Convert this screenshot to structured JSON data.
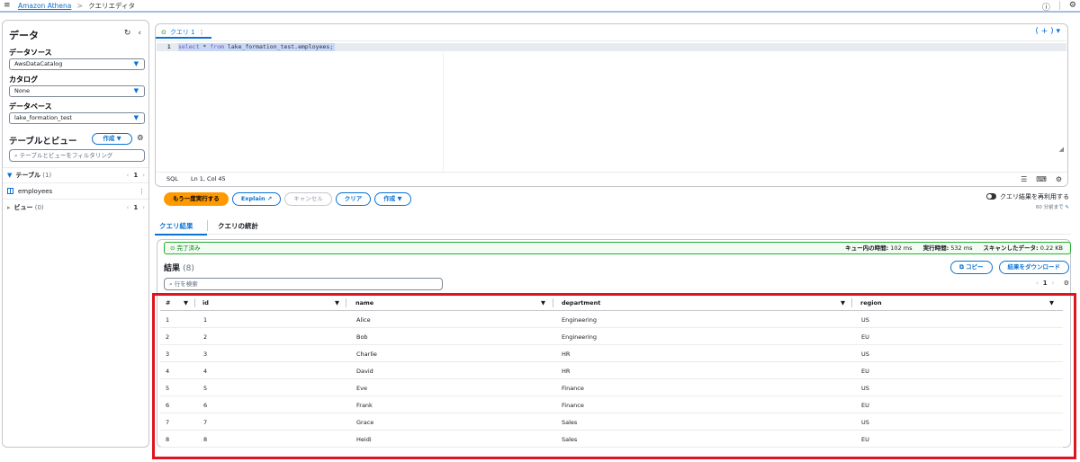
{
  "topbar": {
    "menu_icon": "menu-icon",
    "crumb_link": "Amazon Athena",
    "crumb_sep": ">",
    "crumb_current": "クエリエディタ"
  },
  "left": {
    "title": "データ",
    "datasource_label": "データソース",
    "datasource_value": "AwsDataCatalog",
    "catalog_label": "カタログ",
    "catalog_value": "None",
    "database_label": "データベース",
    "database_value": "lake_formation_test",
    "tables_views_title": "テーブルとビュー",
    "create_label": "作成 ▼",
    "filter_placeholder": "テーブルとビューをフィルタリング",
    "tables_label": "テーブル",
    "tables_count": "(1)",
    "tables_page": "1",
    "table_item": "employees",
    "views_label": "ビュー",
    "views_count": "(0)",
    "views_page": "1"
  },
  "editor": {
    "tab_label": "クエリ 1",
    "line_number": "1",
    "code_select": "select",
    "code_star": "*",
    "code_from": "from",
    "code_rest": "lake_formation_test.employees;",
    "lang": "SQL",
    "position": "Ln 1, Col 45",
    "add_tab": "( + ) ▾"
  },
  "actions": {
    "run_again": "もう一度実行する",
    "explain": "Explain",
    "cancel": "キャンセル",
    "clear": "クリア",
    "create": "作成 ▼",
    "reuse_label": "クエリ結果を再利用する",
    "reuse_sub": "60 分前まで"
  },
  "result_tabs": {
    "results": "クエリ結果",
    "stats": "クエリの統計"
  },
  "status": {
    "completed": "完了済み",
    "queue_label": "キュー内の時間:",
    "queue_value": "102 ms",
    "exec_label": "実行時間:",
    "exec_value": "532 ms",
    "scan_label": "スキャンしたデータ:",
    "scan_value": "0.22 KB"
  },
  "results": {
    "title": "結果",
    "count": "(8)",
    "copy": "コピー",
    "download": "結果をダウンロード",
    "search_placeholder": "行を検索",
    "page": "1"
  },
  "table": {
    "columns": [
      "#",
      "id",
      "name",
      "department",
      "region"
    ],
    "rows": [
      [
        "1",
        "1",
        "Alice",
        "Engineering",
        "US"
      ],
      [
        "2",
        "2",
        "Bob",
        "Engineering",
        "EU"
      ],
      [
        "3",
        "3",
        "Charlie",
        "HR",
        "US"
      ],
      [
        "4",
        "4",
        "David",
        "HR",
        "EU"
      ],
      [
        "5",
        "5",
        "Eve",
        "Finance",
        "US"
      ],
      [
        "6",
        "6",
        "Frank",
        "Finance",
        "EU"
      ],
      [
        "7",
        "7",
        "Grace",
        "Sales",
        "US"
      ],
      [
        "8",
        "8",
        "Heidi",
        "Sales",
        "EU"
      ]
    ]
  },
  "colors": {
    "accent": "#0972d3",
    "primary_button": "#ff9900",
    "success": "#037f0c",
    "highlight": "#e0141e"
  }
}
